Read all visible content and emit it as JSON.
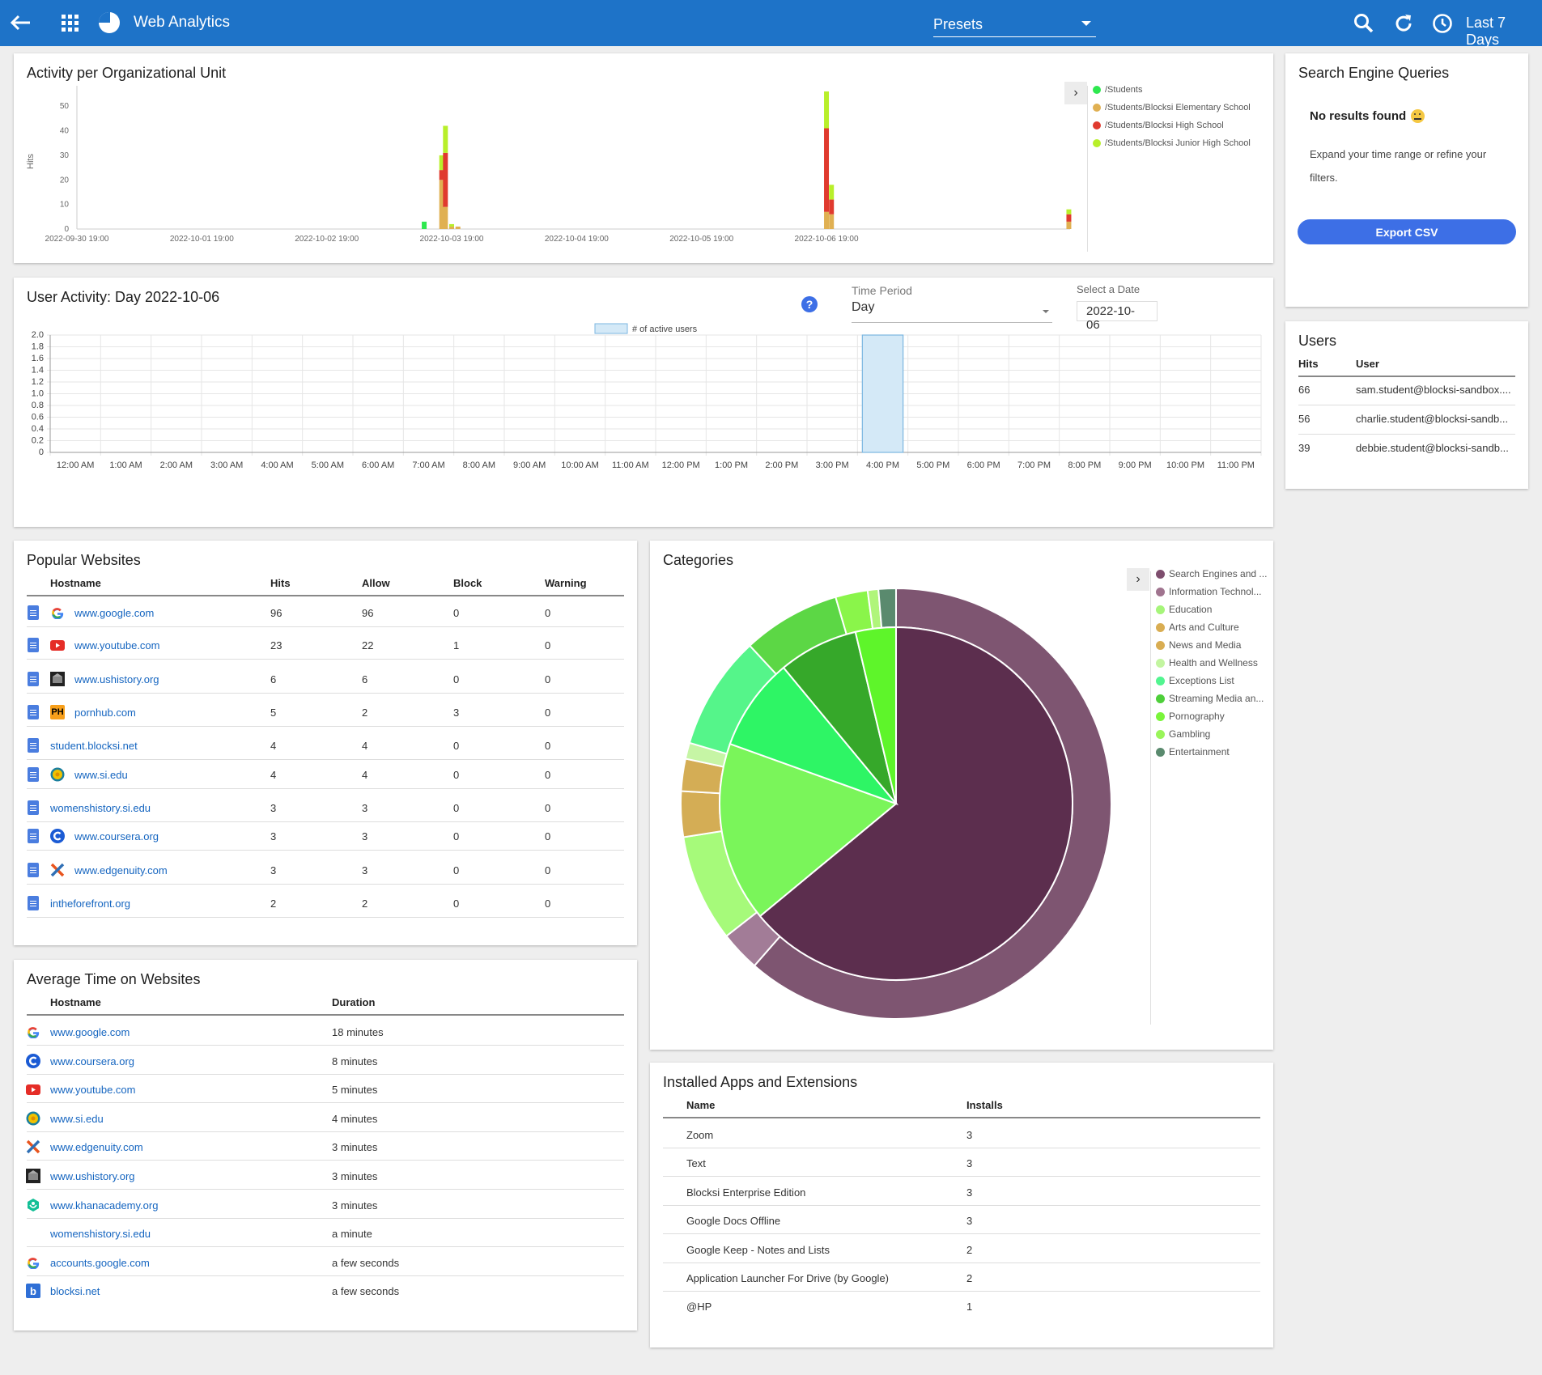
{
  "topbar": {
    "app_title": "Web Analytics",
    "presets_label": "Presets",
    "range_label": "Last 7 Days",
    "icons": [
      "back-arrow-icon",
      "apps-grid-icon",
      "pie-logo-icon",
      "search-icon",
      "refresh-icon",
      "clock-icon",
      "caret-down-icon"
    ]
  },
  "activity_ou": {
    "title": "Activity per Organizational Unit",
    "ylabel": "Hits",
    "legend": [
      {
        "label": "/Students",
        "color": "#2ee84f"
      },
      {
        "label": "/Students/Blocksi Elementary School",
        "color": "#e0b052"
      },
      {
        "label": "/Students/Blocksi High School",
        "color": "#e03a2e"
      },
      {
        "label": "/Students/Blocksi Junior High School",
        "color": "#b8ef2a"
      }
    ]
  },
  "search_queries": {
    "title": "Search Engine Queries",
    "empty_title": "No results found",
    "empty_body_1": "Expand your time range or refine your",
    "empty_body_2": "filters.",
    "export_label": "Export CSV"
  },
  "user_activity": {
    "title": "User Activity: Day 2022-10-06",
    "period_label": "Time Period",
    "period_value": "Day",
    "date_label": "Select a Date",
    "date_value": "2022-10-06",
    "legend_label": "# of active users",
    "help_glyph": "?"
  },
  "users": {
    "title": "Users",
    "col_hits": "Hits",
    "col_user": "User",
    "rows": [
      {
        "hits": "66",
        "user": "sam.student@blocksi-sandbox...."
      },
      {
        "hits": "56",
        "user": "charlie.student@blocksi-sandb..."
      },
      {
        "hits": "39",
        "user": "debbie.student@blocksi-sandb..."
      }
    ]
  },
  "popular": {
    "title": "Popular Websites",
    "cols": [
      "Hostname",
      "Hits",
      "Allow",
      "Block",
      "Warning"
    ],
    "rows": [
      {
        "host": "www.google.com",
        "hits": "96",
        "allow": "96",
        "block": "0",
        "warn": "0",
        "icon": "google-icon"
      },
      {
        "host": "www.youtube.com",
        "hits": "23",
        "allow": "22",
        "block": "1",
        "warn": "0",
        "icon": "youtube-icon"
      },
      {
        "host": "www.ushistory.org",
        "hits": "6",
        "allow": "6",
        "block": "0",
        "warn": "0",
        "icon": "ushistory-icon"
      },
      {
        "host": "pornhub.com",
        "hits": "5",
        "allow": "2",
        "block": "3",
        "warn": "0",
        "icon": "ph-icon"
      },
      {
        "host": "student.blocksi.net",
        "hits": "4",
        "allow": "4",
        "block": "0",
        "warn": "0",
        "icon": ""
      },
      {
        "host": "www.si.edu",
        "hits": "4",
        "allow": "4",
        "block": "0",
        "warn": "0",
        "icon": "si-icon"
      },
      {
        "host": "womenshistory.si.edu",
        "hits": "3",
        "allow": "3",
        "block": "0",
        "warn": "0",
        "icon": ""
      },
      {
        "host": "www.coursera.org",
        "hits": "3",
        "allow": "3",
        "block": "0",
        "warn": "0",
        "icon": "coursera-icon"
      },
      {
        "host": "www.edgenuity.com",
        "hits": "3",
        "allow": "3",
        "block": "0",
        "warn": "0",
        "icon": "edgenuity-icon"
      },
      {
        "host": "intheforefront.org",
        "hits": "2",
        "allow": "2",
        "block": "0",
        "warn": "0",
        "icon": ""
      }
    ],
    "ph_text": "PH"
  },
  "avg_time": {
    "title": "Average Time on Websites",
    "cols": [
      "Hostname",
      "Duration"
    ],
    "rows": [
      {
        "host": "www.google.com",
        "dur": "18 minutes",
        "icon": "google-icon"
      },
      {
        "host": "www.coursera.org",
        "dur": "8 minutes",
        "icon": "coursera-icon"
      },
      {
        "host": "www.youtube.com",
        "dur": "5 minutes",
        "icon": "youtube-icon"
      },
      {
        "host": "www.si.edu",
        "dur": "4 minutes",
        "icon": "si-icon"
      },
      {
        "host": "www.edgenuity.com",
        "dur": "3 minutes",
        "icon": "edgenuity-icon"
      },
      {
        "host": "www.ushistory.org",
        "dur": "3 minutes",
        "icon": "ushistory-icon"
      },
      {
        "host": "www.khanacademy.org",
        "dur": "3 minutes",
        "icon": "khanacademy-icon"
      },
      {
        "host": "womenshistory.si.edu",
        "dur": "a minute",
        "icon": ""
      },
      {
        "host": "accounts.google.com",
        "dur": "a few seconds",
        "icon": "google-icon"
      },
      {
        "host": "blocksi.net",
        "dur": "a few seconds",
        "icon": "blocksi-icon"
      }
    ]
  },
  "categories": {
    "title": "Categories",
    "legend": [
      {
        "label": "Search Engines and ...",
        "color": "#7e4e6e"
      },
      {
        "label": "Information Technol...",
        "color": "#a0748f"
      },
      {
        "label": "Education",
        "color": "#a6f57a"
      },
      {
        "label": "Arts and Culture",
        "color": "#d9ad52"
      },
      {
        "label": "News and Media",
        "color": "#d9ad52"
      },
      {
        "label": "Health and Wellness",
        "color": "#c3f5a0"
      },
      {
        "label": "Exceptions List",
        "color": "#52f590"
      },
      {
        "label": "Streaming Media an...",
        "color": "#4ecf3a"
      },
      {
        "label": "Pornography",
        "color": "#7af53a"
      },
      {
        "label": "Gambling",
        "color": "#9af55a"
      },
      {
        "label": "Entertainment",
        "color": "#5a8a6e"
      }
    ]
  },
  "installed": {
    "title": "Installed Apps and Extensions",
    "cols": [
      "Name",
      "Installs"
    ],
    "rows": [
      {
        "name": "Zoom",
        "n": "3"
      },
      {
        "name": "Text",
        "n": "3"
      },
      {
        "name": "Blocksi Enterprise Edition",
        "n": "3"
      },
      {
        "name": "Google Docs Offline",
        "n": "3"
      },
      {
        "name": "Google Keep - Notes and Lists",
        "n": "2"
      },
      {
        "name": "Application Launcher For Drive (by Google)",
        "n": "2"
      },
      {
        "name": "@HP",
        "n": "1"
      }
    ]
  },
  "chart_data": [
    {
      "type": "bar",
      "title": "Activity per Organizational Unit",
      "ylabel": "Hits",
      "ylim": [
        0,
        55
      ],
      "yticks": [
        0,
        10,
        20,
        30,
        40,
        50
      ],
      "xticks": [
        "2022-09-30 19:00",
        "2022-10-01 19:00",
        "2022-10-02 19:00",
        "2022-10-03 19:00",
        "2022-10-04 19:00",
        "2022-10-05 19:00",
        "2022-10-06 19:00"
      ],
      "x_range_days": [
        0,
        7.95
      ],
      "stacked": true,
      "series_order": [
        "/Students",
        "/Students/Blocksi Elementary School",
        "/Students/Blocksi High School",
        "/Students/Blocksi Junior High School"
      ],
      "bars": [
        {
          "t": 2.78,
          "values": [
            3,
            0,
            0,
            0
          ]
        },
        {
          "t": 2.92,
          "values": [
            0,
            20,
            4,
            6
          ]
        },
        {
          "t": 2.95,
          "values": [
            0,
            9,
            22,
            11
          ]
        },
        {
          "t": 3.0,
          "values": [
            0,
            1,
            0,
            1
          ]
        },
        {
          "t": 3.05,
          "values": [
            0,
            1,
            0,
            0
          ]
        },
        {
          "t": 6.0,
          "values": [
            0,
            7,
            34,
            15
          ]
        },
        {
          "t": 6.04,
          "values": [
            0,
            6,
            6,
            6
          ]
        },
        {
          "t": 7.94,
          "values": [
            0,
            3,
            3,
            2
          ]
        }
      ]
    },
    {
      "type": "bar",
      "title": "User Activity: Day 2022-10-06",
      "series": [
        {
          "name": "# of active users",
          "values": [
            0,
            0,
            0,
            0,
            0,
            0,
            0,
            0,
            0,
            0,
            0,
            0,
            0,
            0,
            0,
            0,
            2,
            0,
            0,
            0,
            0,
            0,
            0,
            0
          ]
        }
      ],
      "categories": [
        "12:00 AM",
        "1:00 AM",
        "2:00 AM",
        "3:00 AM",
        "4:00 AM",
        "5:00 AM",
        "6:00 AM",
        "7:00 AM",
        "8:00 AM",
        "9:00 AM",
        "10:00 AM",
        "11:00 AM",
        "12:00 PM",
        "1:00 PM",
        "2:00 PM",
        "3:00 PM",
        "4:00 PM",
        "5:00 PM",
        "6:00 PM",
        "7:00 PM",
        "8:00 PM",
        "9:00 PM",
        "10:00 PM",
        "11:00 PM"
      ],
      "ylim": [
        0,
        2
      ],
      "yticks": [
        "0",
        "0.2",
        "0.4",
        "0.6",
        "0.8",
        "1.0",
        "1.2",
        "1.4",
        "1.6",
        "1.8",
        "2.0"
      ],
      "grid": true
    },
    {
      "type": "pie",
      "title": "Categories",
      "inner": [
        {
          "label": "Search Engines and ...",
          "value": 64,
          "color": "#5c2e4e"
        },
        {
          "label": "Education",
          "value": 16.5,
          "color": "#7af55a"
        },
        {
          "label": "Exceptions List",
          "value": 8.5,
          "color": "#2ef565"
        },
        {
          "label": "Streaming Media an...",
          "value": 7.3,
          "color": "#36a82a"
        },
        {
          "label": "Pornography",
          "value": 3.7,
          "color": "#5ef52a"
        }
      ],
      "outer": [
        {
          "label": "Search Engines and ...",
          "value": 61,
          "color": "#7e5571"
        },
        {
          "label": "Information Technol...",
          "value": 3,
          "color": "#a27c97"
        },
        {
          "label": "Education",
          "value": 8,
          "color": "#a6fa7a"
        },
        {
          "label": "Arts and Culture",
          "value": 3.4,
          "color": "#d4ad55"
        },
        {
          "label": "News and Media",
          "value": 2.4,
          "color": "#d4ad55"
        },
        {
          "label": "Health and Wellness",
          "value": 1.2,
          "color": "#c6f5a5"
        },
        {
          "label": "Exceptions List",
          "value": 8.5,
          "color": "#55f58a"
        },
        {
          "label": "Streaming Media an...",
          "value": 7.3,
          "color": "#5cd745"
        },
        {
          "label": "Pornography",
          "value": 2.4,
          "color": "#8af54a"
        },
        {
          "label": "Gambling",
          "value": 0.8,
          "color": "#b0f57a"
        },
        {
          "label": "Entertainment",
          "value": 1.3,
          "color": "#5a8a6e"
        }
      ]
    }
  ]
}
